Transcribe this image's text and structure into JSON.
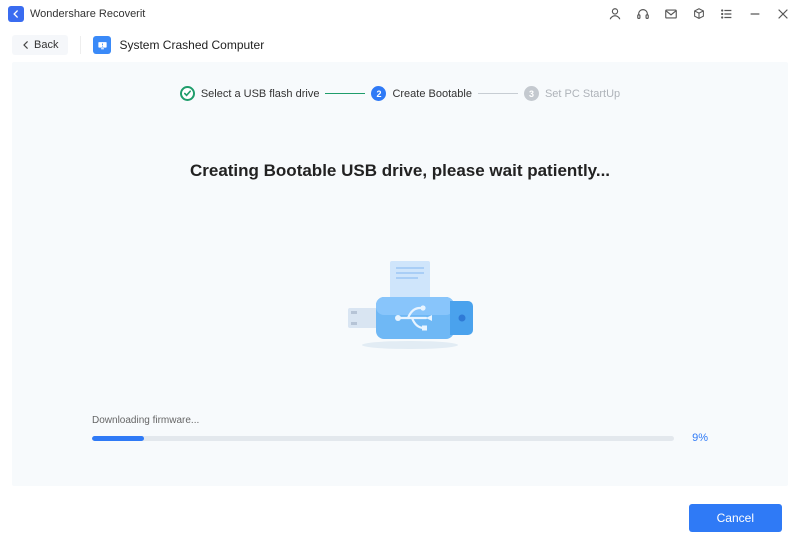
{
  "app": {
    "name": "Wondershare Recoverit"
  },
  "subheader": {
    "back": "Back",
    "crumb": "System Crashed Computer"
  },
  "stepper": {
    "s1": {
      "label": "Select a USB flash drive"
    },
    "s2": {
      "num": "2",
      "label": "Create Bootable"
    },
    "s3": {
      "num": "3",
      "label": "Set PC StartUp"
    }
  },
  "headline": "Creating Bootable USB drive, please wait patiently...",
  "progress": {
    "status": "Downloading firmware...",
    "percent_label": "9%",
    "percent_css": "9%"
  },
  "footer": {
    "cancel": "Cancel"
  }
}
